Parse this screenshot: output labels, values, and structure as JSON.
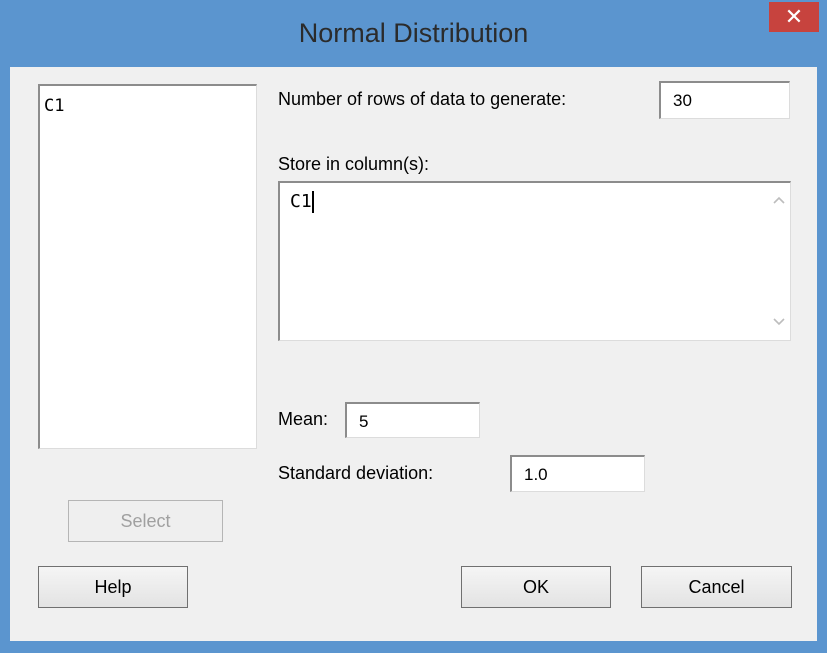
{
  "window": {
    "title": "Normal Distribution",
    "close_glyph": "✕"
  },
  "variables": {
    "items": [
      "C1"
    ]
  },
  "rows": {
    "label": "Number of rows of data to generate:",
    "value": "30"
  },
  "store": {
    "label": "Store in column(s):",
    "value": "C1"
  },
  "mean": {
    "label": "Mean:",
    "value": "5"
  },
  "stdev": {
    "label": "Standard deviation:",
    "value": "1.0"
  },
  "buttons": {
    "select": "Select",
    "help": "Help",
    "ok": "OK",
    "cancel": "Cancel"
  },
  "icons": {
    "close": "close-icon",
    "scroll_up": "chevron-up-icon",
    "scroll_down": "chevron-down-icon"
  },
  "colors": {
    "titlebar": "#5b95cf",
    "close_button": "#c7433e",
    "client_bg": "#f0f0f0"
  }
}
